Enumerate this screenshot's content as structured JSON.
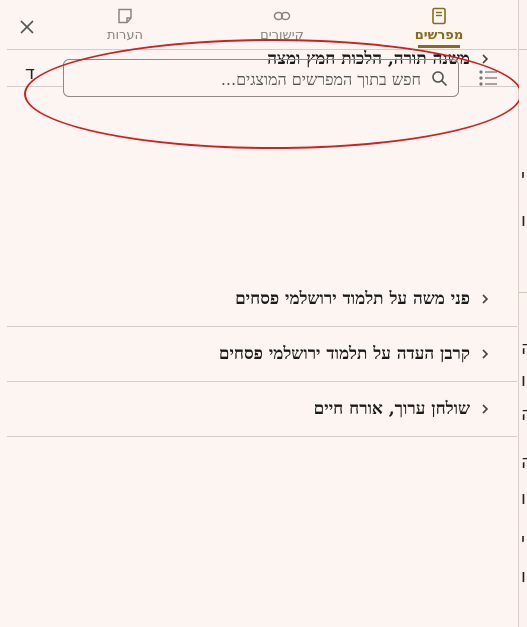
{
  "tabs": [
    {
      "label": "מפרשים",
      "icon": "book-icon",
      "active": true
    },
    {
      "label": "קישורים",
      "icon": "link-icon",
      "active": false
    },
    {
      "label": "הערות",
      "icon": "note-icon",
      "active": false
    }
  ],
  "close_icon": "close-icon",
  "search": {
    "placeholder": "חפש בתוך המפרשים המוצגים..."
  },
  "commentaries": [
    {
      "title": "משנה תורה, הלכות חמץ ומצה"
    },
    {
      "title": "פני משה על תלמוד ירושלמי פסחים"
    },
    {
      "title": "קרבן העדה על תלמוד ירושלמי פסחים"
    },
    {
      "title": "שולחן ערוך, אורח חיים"
    }
  ],
  "colors": {
    "accent": "#8a6a1c",
    "annotation": "#d21f1f",
    "background": "#fdf5f1"
  }
}
